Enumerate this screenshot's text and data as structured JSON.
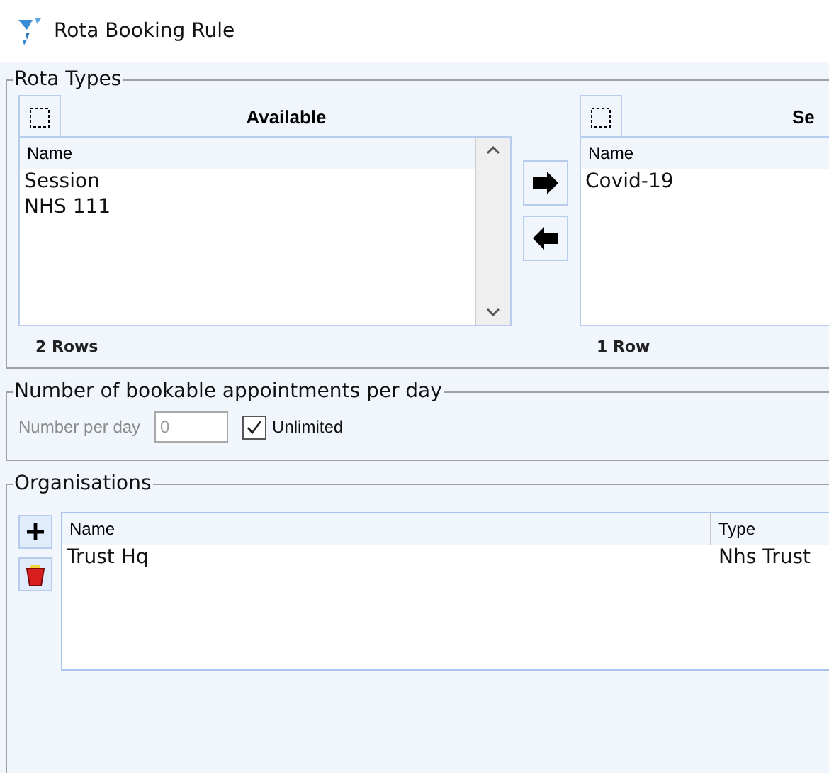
{
  "window": {
    "title": "Rota Booking Rule"
  },
  "rota_types": {
    "legend": "Rota Types",
    "available": {
      "header": "Available",
      "column": "Name",
      "rows": [
        "Session",
        "NHS 111"
      ],
      "count": "2 Rows"
    },
    "selected": {
      "header": "Se",
      "column": "Name",
      "rows": [
        "Covid-19"
      ],
      "count": "1 Row"
    }
  },
  "appointments": {
    "legend": "Number of bookable appointments per day",
    "label": "Number per day",
    "value": "0",
    "disabled": true,
    "unlimited": {
      "label": "Unlimited",
      "checked": true
    }
  },
  "organisations": {
    "legend": "Organisations",
    "columns": [
      "Name",
      "Type"
    ],
    "rows": [
      {
        "name": "Trust Hq",
        "type": "Nhs Trust"
      }
    ]
  }
}
